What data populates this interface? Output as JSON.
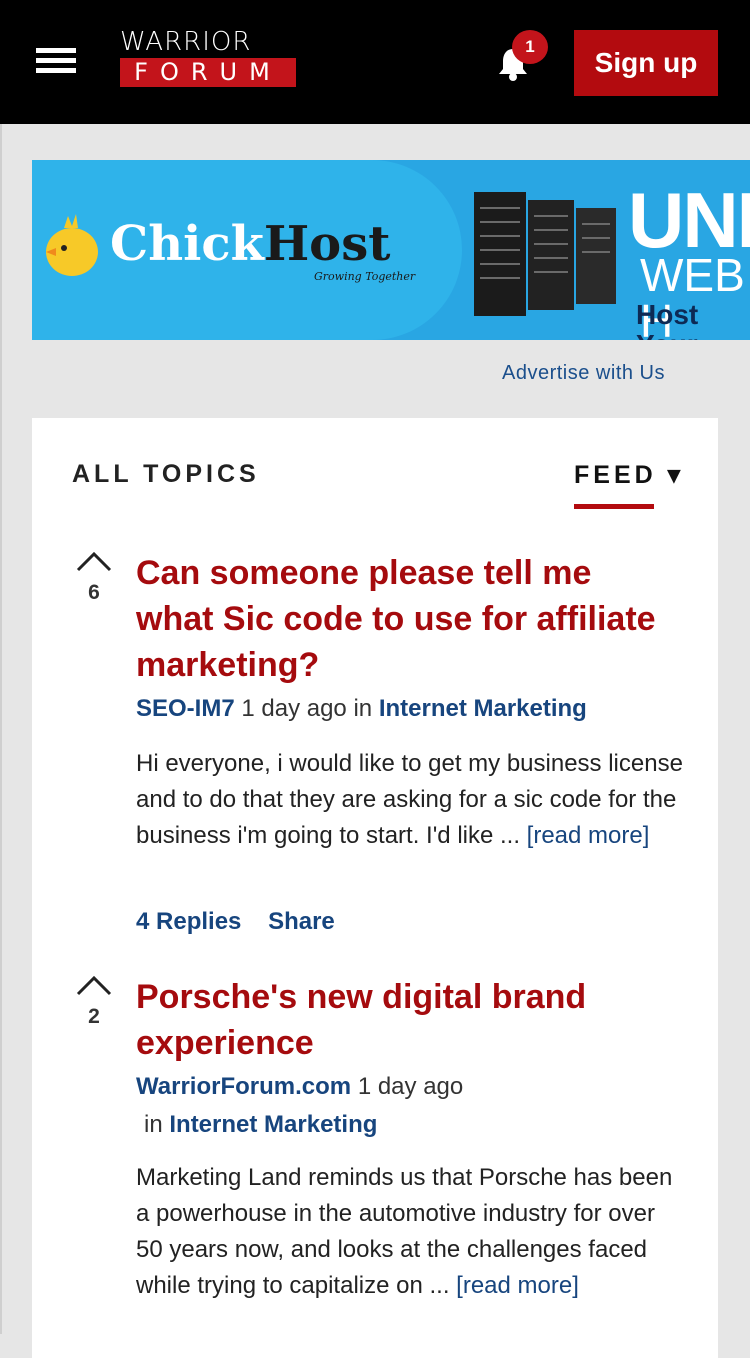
{
  "header": {
    "logo_top": "WARRIOR",
    "logo_bottom": "FORUM",
    "notification_count": "1",
    "signup_label": "Sign up"
  },
  "ad": {
    "brand_light": "Chick",
    "brand_dark": "Host",
    "tagline": "Growing Together",
    "headline": "UNL",
    "subline": "WEB H",
    "subline2": "Host Your"
  },
  "advertise_label": "Advertise with Us",
  "topics": {
    "heading": "ALL TOPICS",
    "feed_label": "FEED ▾"
  },
  "posts": [
    {
      "votes": "6",
      "title": "Can someone please tell me what Sic code to use for affiliate marketing?",
      "author": "SEO-IM7",
      "time": "1 day ago",
      "in": "in",
      "category": "Internet Marketing",
      "excerpt": "Hi everyone, i would like to get my business license and to do that they are asking for a sic code for the business i'm going to start. I'd like ...",
      "read_more": "[read more]",
      "replies": "4 Replies",
      "share": "Share"
    },
    {
      "votes": "2",
      "title": "Porsche's new digital brand experience",
      "author": "WarriorForum.com",
      "time": "1 day ago",
      "in": "in",
      "category": "Internet Marketing",
      "excerpt": "Marketing Land reminds us that Porsche has been a powerhouse in the automotive industry for over 50 years now, and looks at the challenges faced while trying to capitalize on ...",
      "read_more": "[read more]"
    }
  ],
  "colors": {
    "brand_red": "#b30b0f",
    "link_blue": "#17457e",
    "title_red": "#a50b0e"
  }
}
